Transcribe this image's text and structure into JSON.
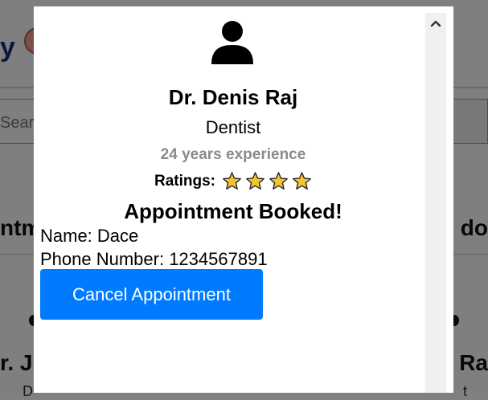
{
  "background": {
    "logo_text": "y",
    "search_placeholder": "Sear",
    "section_left": "ntm",
    "section_right": "l do",
    "card_left_name": "r. Ji",
    "card_left_sub": "D",
    "card_right_name": "s Ra",
    "card_right_sub": "t"
  },
  "modal": {
    "avatar_icon": "user-icon",
    "doctor_name": "Dr. Denis Raj",
    "specialty": "Dentist",
    "experience": "24 years experience",
    "ratings_label": "Ratings:",
    "rating_stars": 4,
    "star_color": "#f4c430",
    "booked_title": "Appointment Booked!",
    "patient_name_line": "Name: Dace",
    "patient_phone_line": "Phone Number: 1234567891",
    "cancel_button_label": "Cancel Appointment",
    "cancel_button_color": "#007bff",
    "scroll_icon": "chevron-up-icon"
  }
}
